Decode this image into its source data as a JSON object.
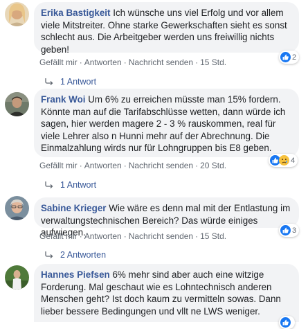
{
  "comments": [
    {
      "author": "Erika Bastigkeit",
      "text": "Ich wünsche uns viel Erfolg und vor allem viele Mitstreiter. Ohne starke Gewerkschaften sieht es sonst schlecht aus. Die Arbeitgeber werden uns freiwillig nichts geben!",
      "like_label": "Gefällt mir",
      "reply_label": "Antworten",
      "message_label": "Nachricht senden",
      "time": "15 Std.",
      "reaction_count": "2",
      "reactions": [
        "like"
      ],
      "replies_label": "1 Antwort"
    },
    {
      "author": "Frank Woi",
      "text": "Um 6% zu erreichen müsste man 15% fordern. Könnte man auf die Tarifabschlüsse wetten, dann würde ich sagen, hier werden magere 2 - 3 % rauskommen, real für viele Lehrer also n Hunni mehr auf der Abrechnung. Die Einmalzahlung wirds nur für Lohngruppen bis E8 geben.",
      "like_label": "Gefällt mir",
      "reply_label": "Antworten",
      "message_label": "Nachricht senden",
      "time": "20 Std.",
      "reaction_count": "4",
      "reactions": [
        "like",
        "sad"
      ],
      "replies_label": "1 Antwort"
    },
    {
      "author": "Sabine Krieger",
      "text": "Wie wäre es denn mal mit der Entlastung im verwaltungstechnischen Bereich? Das würde einiges aufwiegen.",
      "like_label": "Gefällt mir",
      "reply_label": "Antworten",
      "message_label": "Nachricht senden",
      "time": "15 Std.",
      "reaction_count": "3",
      "reactions": [
        "like"
      ],
      "replies_label": "2 Antworten"
    },
    {
      "author": "Hannes Piefsen",
      "text": "6% mehr sind aber auch eine witzige Forderung. Mal geschaut wie es Lohntechnisch anderen Menschen geht? Ist doch kaum zu vermitteln sowas. Dann lieber bessere Bedingungen und vllt ne LWS weniger.",
      "reaction_count": "",
      "reactions": [
        "like"
      ]
    }
  ],
  "colors": {
    "author": "#385898",
    "bubble": "#f2f3f5",
    "meta": "#606770",
    "like": "#1877f2"
  },
  "icons": {
    "like": "thumbs-up-icon",
    "sad": "sad-face-icon",
    "reply": "reply-arrow-icon"
  }
}
